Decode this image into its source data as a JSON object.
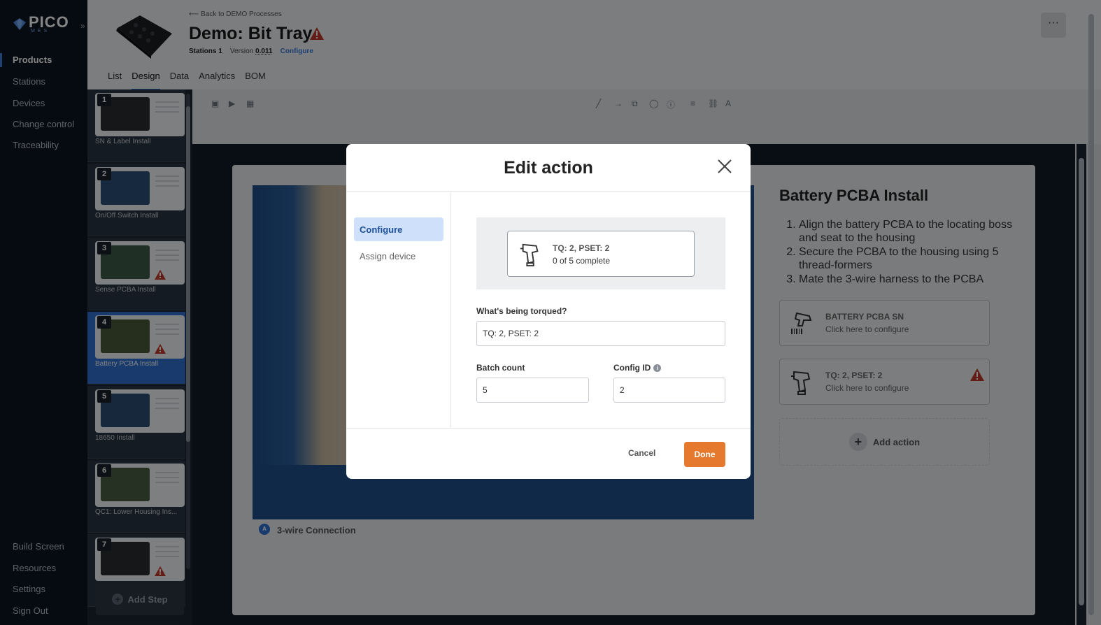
{
  "app": {
    "logo_text": "PICO",
    "logo_sub": "MES"
  },
  "sidebar": {
    "items": [
      {
        "label": "Products",
        "active": true
      },
      {
        "label": "Stations"
      },
      {
        "label": "Devices"
      },
      {
        "label": "Change control"
      },
      {
        "label": "Traceability"
      }
    ],
    "bottom_items": [
      {
        "label": "Build Screen"
      },
      {
        "label": "Resources"
      },
      {
        "label": "Settings"
      },
      {
        "label": "Sign Out"
      }
    ]
  },
  "header": {
    "back_link": "Back to DEMO Processes",
    "title": "Demo: Bit Tray",
    "stations_label": "Stations",
    "stations_value": "1",
    "version_label": "Version",
    "version_value": "0.011",
    "configure_link": "Configure",
    "more": "···"
  },
  "tabs": [
    {
      "label": "List"
    },
    {
      "label": "Design",
      "active": true
    },
    {
      "label": "Data"
    },
    {
      "label": "Analytics"
    },
    {
      "label": "BOM"
    }
  ],
  "steps": [
    {
      "num": "1",
      "label": "SN & Label Install",
      "warning": false
    },
    {
      "num": "2",
      "label": "On/Off Switch Install",
      "warning": false
    },
    {
      "num": "3",
      "label": "Sense PCBA Install",
      "warning": true
    },
    {
      "num": "4",
      "label": "Battery PCBA Install",
      "warning": true,
      "active": true
    },
    {
      "num": "5",
      "label": "18650 Install",
      "warning": false
    },
    {
      "num": "6",
      "label": "QC1: Lower Housing Ins...",
      "warning": false
    },
    {
      "num": "7",
      "label": "",
      "warning": true
    }
  ],
  "add_step": "Add Step",
  "canvas": {
    "marker_letter": "A",
    "marker_label": "3-wire Connection",
    "step_title": "Battery PCBA Install",
    "instructions": [
      "Align the battery PCBA to the locating boss and seat to the housing",
      "Secure the PCBA to the housing using 5 thread-formers",
      "Mate the 3-wire harness to the PCBA"
    ],
    "actions": [
      {
        "title": "BATTERY PCBA SN",
        "subtitle": "Click here to configure",
        "icon": "barcode-scanner-icon",
        "warning": false
      },
      {
        "title": "TQ: 2, PSET: 2",
        "subtitle": "Click here to configure",
        "icon": "torque-driver-icon",
        "warning": true
      }
    ],
    "add_action": "Add action"
  },
  "modal": {
    "title": "Edit action",
    "side_items": [
      {
        "label": "Configure",
        "active": true
      },
      {
        "label": "Assign device"
      }
    ],
    "preview": {
      "title": "TQ: 2, PSET: 2",
      "subtitle": "0 of 5 complete"
    },
    "torqued_label": "What's being torqued?",
    "torqued_value": "TQ: 2, PSET: 2",
    "batch_label": "Batch count",
    "batch_value": "5",
    "config_label": "Config ID",
    "config_value": "2",
    "cancel": "Cancel",
    "done": "Done"
  },
  "colors": {
    "accent": "#2f6fd1",
    "primary_button": "#e57a2f",
    "warning": "#c0392b",
    "sidebar_bg": "#0c1622"
  }
}
